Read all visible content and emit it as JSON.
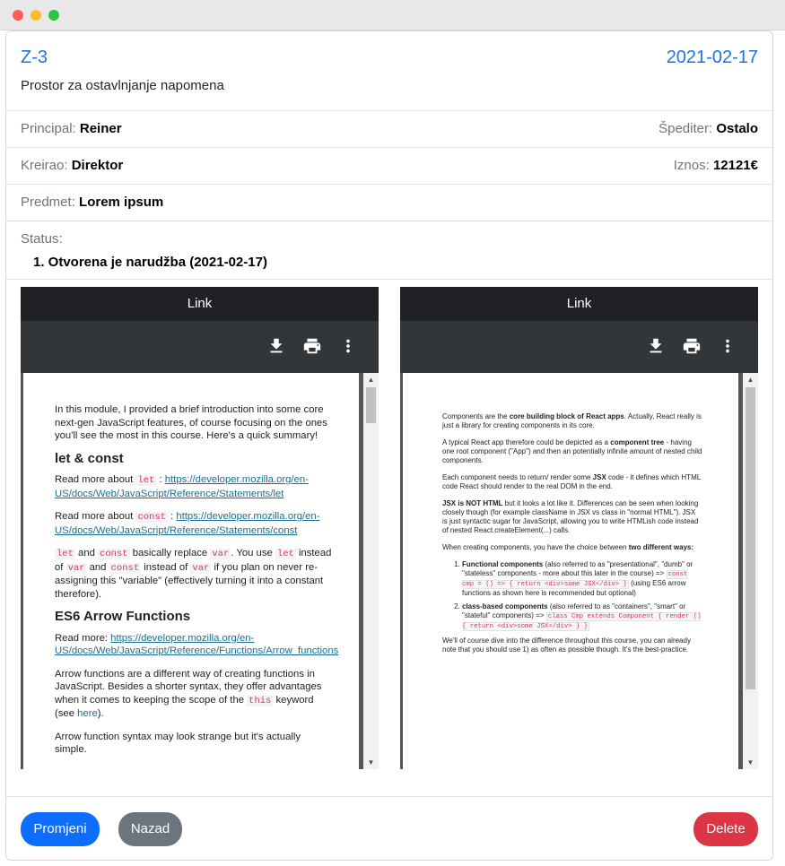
{
  "order": {
    "code": "Z-3",
    "date": "2021-02-17",
    "note": "Prostor za ostavlnjanje napomena"
  },
  "details": {
    "principal_label": "Principal:",
    "principal_value": "Reiner",
    "spediter_label": "Špediter:",
    "spediter_value": "Ostalo",
    "kreirao_label": "Kreirao:",
    "kreirao_value": "Direktor",
    "iznos_label": "Iznos:",
    "iznos_value": "12121€",
    "predmet_label": "Predmet:",
    "predmet_value": "Lorem ipsum",
    "status_label": "Status:",
    "status_items": [
      "1. Otvorena je narudžba (2021-02-17)"
    ]
  },
  "viewers": [
    {
      "title": "Link",
      "toolbar_icons": [
        "download-icon",
        "print-icon",
        "more-vert-icon"
      ],
      "scroll_fraction": 0.07,
      "page": {
        "intro": "In this module, I provided a brief introduction into some core next-gen JavaScript features, of course focusing on the ones you'll see the most in this course. Here's a quick summary!",
        "h_let": "let & const",
        "read_more": "Read more about",
        "code_let": "let",
        "colon": ":",
        "link_let": "https://developer.mozilla.org/en-US/docs/Web/JavaScript/Reference/Statements/let",
        "code_const": "const",
        "link_const": "https://developer.mozilla.org/en-US/docs/Web/JavaScript/Reference/Statements/const",
        "and": "and",
        "basically_replace": "basically replace",
        "code_var": "var",
        "you_use": ". You use",
        "instead_of": "instead of",
        "and_2": "and",
        "instead_of_2": "instead of",
        "if_you_plan": "if you plan on never re-assigning this \"variable\" (effectively turning it into a constant therefore).",
        "h_arrow": "ES6 Arrow Functions",
        "read_more_2": "Read more:",
        "link_arrow": "https://developer.mozilla.org/en-US/docs/Web/JavaScript/Reference/Functions/Arrow_functions",
        "arrow_p1": "Arrow functions are a different way of creating functions in JavaScript. Besides a shorter syntax, they offer advantages when it comes to keeping the scope of the",
        "code_this": "this",
        "keyword": "keyword (see",
        "here": "here",
        "close": ").",
        "arrow_p2": "Arrow function syntax may look strange but it's actually simple."
      }
    },
    {
      "title": "Link",
      "toolbar_icons": [
        "download-icon",
        "print-icon",
        "more-vert-icon"
      ],
      "scroll_fraction": 0.0,
      "page": {
        "p1_a": "Components are the",
        "p1_b": "core building block of React apps",
        "p1_c": ". Actually, React really is just a library for creating components in its core.",
        "p2_a": "A typical React app therefore could be depicted as a",
        "p2_b": "component tree",
        "p2_c": "- having one root component (\"App\") and then an potentially infinite amount of nested child components.",
        "p3_a": "Each component needs to return/ render some",
        "p3_b": "JSX",
        "p3_c": "code - it defines which HTML code React should render to the real DOM in the end.",
        "p4_a": "JSX is NOT HTML",
        "p4_b": "but it looks a lot like it. Differences can be seen when looking closely though (for example className in JSX vs class in \"normal HTML\"). JSX is just syntactic sugar for JavaScript, allowing you to write HTMLish code instead of nested React.createElement(...) calls.",
        "p5_a": "When creating components, you have the choice between",
        "p5_b": "two different ways:",
        "li1_a": "Functional components",
        "li1_b": "(also referred to as \"presentational\", \"dumb\" or \"stateless\" components - more about this later in the course) =>",
        "li1_code": "const cmp = () => { return <div>some JSX</div> }",
        "li1_c": "(using ES6 arrow functions as shown here is recommended but optional)",
        "li2_a": "class-based components",
        "li2_b": "(also referred to as \"containers\", \"smart\" or \"stateful\" components) =>",
        "li2_code": "class Cmp extends Component { render () { return <div>some JSX</div> } }",
        "p6": "We'll of course dive into the difference throughout this course, you can already note that you should use 1) as often as possible though. It's the best-practice."
      }
    }
  ],
  "footer": {
    "edit_label": "Promjeni",
    "back_label": "Nazad",
    "delete_label": "Delete"
  },
  "colors": {
    "accent": "#1a73e8",
    "primary_button": "#0d6efd",
    "secondary_button": "#6c757d",
    "danger_button": "#dc3545"
  }
}
